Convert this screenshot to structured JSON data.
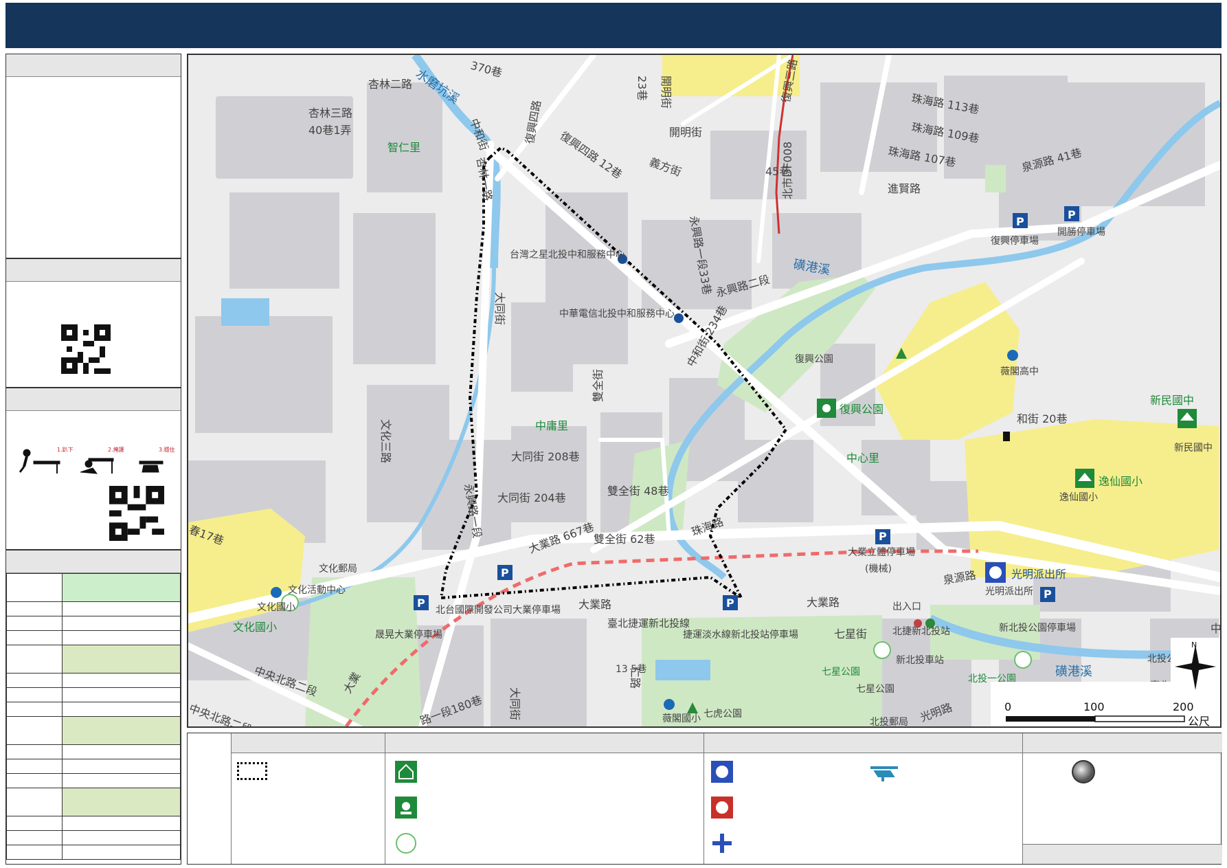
{
  "map": {
    "scale": {
      "ticks": [
        "0",
        "100",
        "200"
      ],
      "unit": "公尺"
    },
    "north": "N",
    "labels": {
      "l01": "杏林二路",
      "l02": "杏林三路",
      "l03": "40巷1弄",
      "l04": "水磨坑溪",
      "l05": "智仁里",
      "l06": "中和街",
      "l07": "370巷",
      "l08": "杏林一路",
      "l09": "復興四路",
      "l10": "復興四路 12巷",
      "l11": "開明街",
      "l12": "23巷",
      "l13": "開明街",
      "l14": "義方街",
      "l15": "復興三路",
      "l16": "45巷",
      "l17": "北市DF008",
      "l18": "珠海路 113巷",
      "l19": "珠海路 109巷",
      "l20": "珠海路 107巷",
      "l21": "泉源路 41巷",
      "l22": "進賢路",
      "l23": "復興停車場",
      "l24": "開勝停車場",
      "l25": "磺港溪",
      "l26": "永興路一段33巷",
      "l27": "台灣之星北投中和服務中心",
      "l28": "中華電信北投中和服務中心",
      "l29": "永興路二段",
      "l30": "中和街 234巷",
      "l31": "大同街",
      "l32": "中庸里",
      "l33": "復興公園",
      "l34": "復興公園",
      "l35": "薇閣高中",
      "l36": "和街 20巷",
      "l37": "中心里",
      "l38": "新民國中",
      "l39": "新民國中",
      "l40": "逸仙國小",
      "l41": "逸仙國小",
      "l42": "文化三路",
      "l43": "永興路一段",
      "l44": "大同街 208巷",
      "l45": "大同街 204巷",
      "l46": "雙全街 48巷",
      "l47": "雙全街",
      "l48": "大業路 667巷",
      "l49": "雙全街 62巷",
      "l50": "珠海路",
      "l51": "大業立體停車場",
      "l52": "(機械)",
      "l53": "泉源路",
      "l54": "光明派出所",
      "l55": "光明派出所",
      "l56": "文化郵局",
      "l57": "文化活動中心",
      "l58": "文化國小",
      "l59": "文化國小",
      "l60": "北台國際開發公司大業停車場",
      "l61": "大業路",
      "l62": "大業路",
      "l63": "出入口",
      "l64": "臺北捷運新北投線",
      "l65": "晟晃大業停車場",
      "l66": "捷運淡水線新北投站停車場",
      "l67": "七星街",
      "l68": "北捷新北投站",
      "l69": "新北投車站",
      "l70": "七星公園",
      "l71": "七星公園",
      "l72": "新北投公園停車場",
      "l73": "北投一公園",
      "l74": "磺港溪",
      "l75": "北投公",
      "l76": "臺北市",
      "l77": "中央北路二段",
      "l78": "中央北路二段95巷",
      "l79": "路一段180巷",
      "l80": "大同街",
      "l81": "仁路",
      "l82": "13 5巷",
      "l83": "薇閣國小",
      "l84": "七虎公園",
      "l85": "北投郵局",
      "l86": "光明路",
      "l87": "大業",
      "l88": "春17巷",
      "l89": "中央"
    }
  },
  "colors": {
    "title_bar": "#15355a",
    "school": "#f6ee8c",
    "park": "#cfe8c4",
    "water": "#8ec8ec",
    "boundary": "#000000",
    "metro": "#ef6b6b",
    "map_bg": "#ececec",
    "building": "#d0d0d4"
  },
  "side_table": {
    "row_fills": [
      "#cdeecb",
      "#fff",
      "#fff",
      "#fff",
      "#dbe9c2",
      "#fff",
      "#fff",
      "#fff",
      "#dbe9c2",
      "#fff",
      "#fff",
      "#fff",
      "#dbe9c2",
      "#fff",
      "#fff",
      "#fff"
    ]
  },
  "quake": {
    "step1": "1.趴下",
    "step2": "2.掩護",
    "step3": "3.穩住"
  },
  "legend": {
    "icons": [
      "boundary-icon",
      "shelter-icon",
      "evacuation-park-icon",
      "reserve-icon",
      "police-icon",
      "fire-icon",
      "medical-icon",
      "helipad-icon",
      "landmark-icon"
    ]
  }
}
